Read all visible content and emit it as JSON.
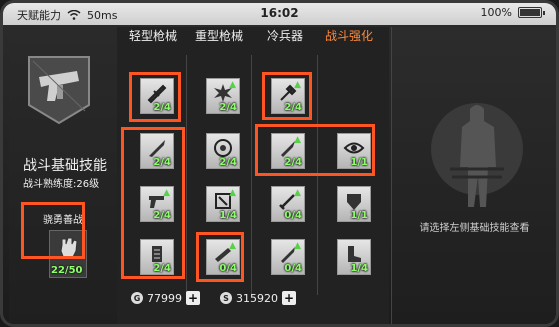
{
  "status": {
    "carrier": "天赋能力",
    "signal": "50ms",
    "time": "16:02",
    "battery": "100%"
  },
  "left": {
    "title": "战斗基础技能",
    "level": "战斗熟练度:26级",
    "brave_label": "骁勇善战",
    "brave_count": "22/50"
  },
  "columns": [
    "轻型枪械",
    "重型枪械",
    "冷兵器",
    "战斗强化"
  ],
  "cells": [
    [
      "2/4",
      "2/4",
      "2/4",
      ""
    ],
    [
      "2/4",
      "2/4",
      "2/4",
      "1/1"
    ],
    [
      "2/4",
      "1/4",
      "0/4",
      "1/1"
    ],
    [
      "2/4",
      "0/4",
      "0/4",
      "1/4"
    ]
  ],
  "currency": {
    "gold": "77999",
    "silver": "315920"
  },
  "hint": "请选择左侧基础技能查看",
  "colors": {
    "highlight": "#ff5522",
    "count": "#8cff6a"
  }
}
